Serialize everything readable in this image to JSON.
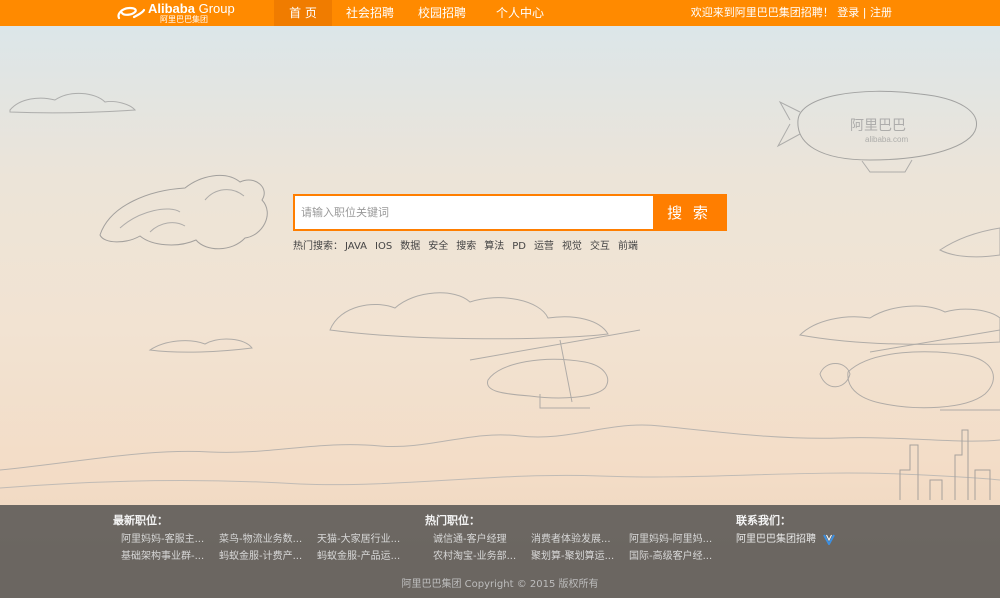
{
  "header": {
    "logo": {
      "brand": "Alibaba",
      "brand_suffix": "Group",
      "sub": "阿里巴巴集团"
    },
    "nav": [
      {
        "label": "首  页",
        "active": true
      },
      {
        "label": "社会招聘",
        "active": false
      },
      {
        "label": "校园招聘",
        "active": false
      },
      {
        "label": "个人中心",
        "active": false
      }
    ],
    "welcome": "欢迎来到阿里巴巴集团招聘！",
    "login": "登录",
    "separator": "|",
    "register": "注册"
  },
  "search": {
    "placeholder": "请输入职位关键词",
    "value": "",
    "button": "搜 索",
    "hot_label": "热门搜索：",
    "hot_keywords": [
      "JAVA",
      "IOS",
      "数据",
      "安全",
      "搜索",
      "算法",
      "PD",
      "运营",
      "视觉",
      "交互",
      "前端"
    ]
  },
  "footer": {
    "latest": {
      "title": "最新职位：",
      "items": [
        "阿里妈妈-客服主...",
        "菜鸟-物流业务数...",
        "天猫-大家居行业...",
        "基础架构事业群-...",
        "蚂蚁金服-计费产...",
        "蚂蚁金服-产品运..."
      ]
    },
    "hot": {
      "title": "热门职位：",
      "items": [
        "诚信通-客户经理",
        "消费者体验发展...",
        "阿里妈妈-阿里妈...",
        "农村淘宝-业务部...",
        "聚划算-聚划算运...",
        "国际-高级客户经..."
      ]
    },
    "contact": {
      "title": "联系我们：",
      "weibo": "阿里巴巴集团招聘"
    },
    "copyright": "阿里巴巴集团 Copyright © 2015 版权所有"
  },
  "colors": {
    "accent": "#ff7e00",
    "topbar": "#ff8a00",
    "footer_bg": "#464646"
  }
}
